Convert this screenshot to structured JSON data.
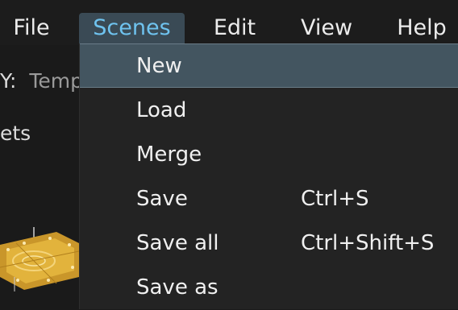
{
  "menubar": {
    "items": [
      {
        "label": "File"
      },
      {
        "label": "Scenes"
      },
      {
        "label": "Edit"
      },
      {
        "label": "View"
      },
      {
        "label": "Help"
      }
    ]
  },
  "background": {
    "category_key": "Y:",
    "category_value": "Templ",
    "assets_label": "ets"
  },
  "dropdown": {
    "items": [
      {
        "label": "New",
        "shortcut": ""
      },
      {
        "label": "Load",
        "shortcut": ""
      },
      {
        "label": "Merge",
        "shortcut": ""
      },
      {
        "label": "Save",
        "shortcut": "Ctrl+S"
      },
      {
        "label": "Save all",
        "shortcut": "Ctrl+Shift+S"
      },
      {
        "label": "Save as",
        "shortcut": ""
      }
    ]
  },
  "colors": {
    "active_menu_bg": "#3a4a55",
    "active_menu_text": "#6fc3ef",
    "highlight_bg": "#435560",
    "menu_bg": "#232323"
  },
  "icons": [
    "scene-thumbnail-icon"
  ]
}
